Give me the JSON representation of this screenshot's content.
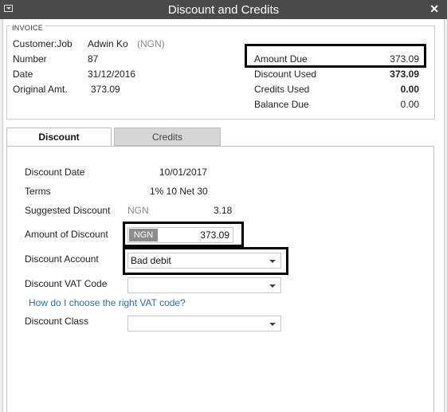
{
  "window": {
    "title": "Discount and Credits"
  },
  "invoice": {
    "header": "INVOICE",
    "customer_label": "Customer:Job",
    "customer_value": "Adwin Ko",
    "customer_currency": "(NGN)",
    "number_label": "Number",
    "number_value": "87",
    "date_label": "Date",
    "date_value": "31/12/2016",
    "original_label": "Original Amt.",
    "original_value": "373.09",
    "amount_due_label": "Amount Due",
    "amount_due_value": "373.09",
    "discount_used_label": "Discount Used",
    "discount_used_value": "373.09",
    "credits_used_label": "Credits Used",
    "credits_used_value": "0.00",
    "balance_due_label": "Balance Due",
    "balance_due_value": "0.00"
  },
  "tabs": [
    {
      "label": "Discount",
      "active": true
    },
    {
      "label": "Credits",
      "active": false
    }
  ],
  "discount": {
    "date_label": "Discount Date",
    "date_value": "10/01/2017",
    "terms_label": "Terms",
    "terms_value": "1% 10 Net 30",
    "suggested_label": "Suggested Discount",
    "suggested_currency": "NGN",
    "suggested_value": "3.18",
    "amount_label": "Amount of Discount",
    "amount_currency": "NGN",
    "amount_value": "373.09",
    "account_label": "Discount Account",
    "account_value": "Bad debit",
    "vat_label": "Discount VAT Code",
    "vat_value": "",
    "vat_help_link": "How do I choose the right VAT code?",
    "class_label": "Discount Class",
    "class_value": ""
  }
}
